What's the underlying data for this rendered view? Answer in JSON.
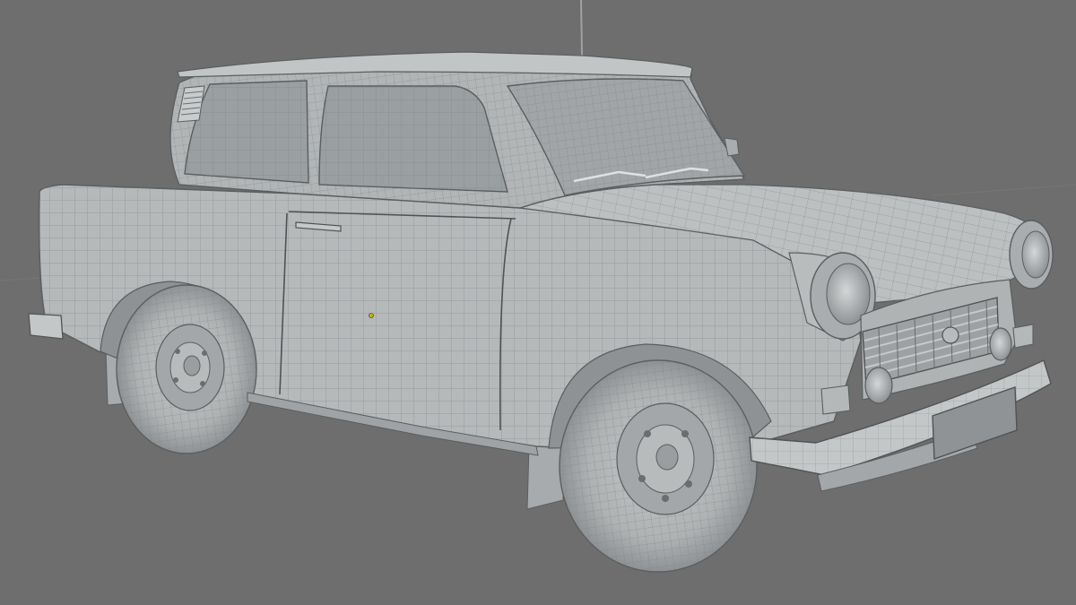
{
  "viewport": {
    "background": "#6e6e6e",
    "grid_line_color": "#727272",
    "object_name": "car-wireframe-model",
    "origin_marker_color": "#c8b400"
  },
  "model": {
    "body_color": "#b6b9ba",
    "body_shadow": "#8e9294",
    "body_highlight": "#cfd2d3",
    "edge_color": "#5a5e60",
    "wire_color": "#7e8385",
    "glass_color": "#9a9fa1",
    "tire_color": "#a9adaf",
    "antenna_color": "#9ea2a4",
    "plate_color": "#8f9395"
  }
}
